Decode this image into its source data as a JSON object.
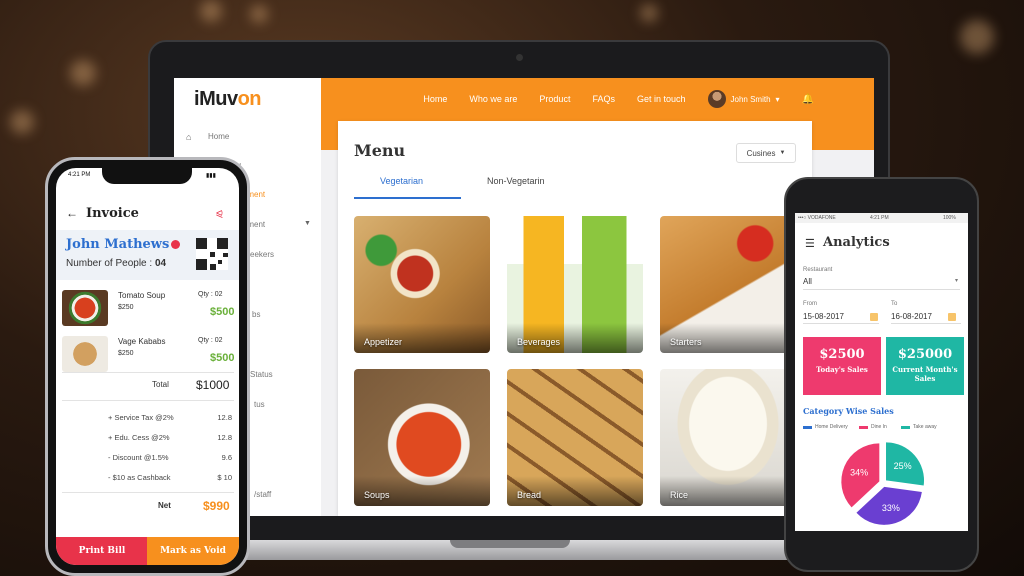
{
  "site": {
    "logo_prefix": "i",
    "logo_text": "Muv",
    "logo_accent": "on",
    "nav": [
      "Home",
      "Who we are",
      "Product",
      "FAQs",
      "Get in touch"
    ],
    "user_name": "John Smith",
    "user_caret": "▾"
  },
  "sidebar": {
    "items": [
      {
        "label": "Home",
        "active": false
      },
      {
        "label": "rd",
        "active": false
      },
      {
        "label": "agement",
        "active": true
      },
      {
        "label": "agement",
        "active": false
      },
      {
        "label": "eekers",
        "active": false
      },
      {
        "label": "bs",
        "active": false
      },
      {
        "label": "Status",
        "active": false
      },
      {
        "label": "tus",
        "active": false
      },
      {
        "label": "/staff",
        "active": false
      }
    ]
  },
  "menu": {
    "title": "Menu",
    "cuisines_label": "Cusines",
    "tabs": [
      {
        "label": "Vegetarian",
        "active": true
      },
      {
        "label": "Non-Vegetarin",
        "active": false
      }
    ],
    "tiles": [
      "Appetizer",
      "Beverages",
      "Starters",
      "Soups",
      "Bread",
      "Rice"
    ]
  },
  "invoice": {
    "status_time": "4:21 PM",
    "title": "Invoice",
    "customer_name": "John Mathews",
    "people_label": "Number of People :",
    "people_count": "04",
    "items": [
      {
        "name": "Tomato Soup",
        "price": "$250",
        "qty": "Qty : 02",
        "amount": "$500"
      },
      {
        "name": "Vage Kababs",
        "price": "$250",
        "qty": "Qty : 02",
        "amount": "$500"
      }
    ],
    "total_label": "Total",
    "total_value": "$1000",
    "adjustments": [
      {
        "label": "+ Service Tax @2%",
        "value": "12.8"
      },
      {
        "label": "+ Edu. Cess @2%",
        "value": "12.8"
      },
      {
        "label": "- Discount @1.5%",
        "value": "9.6"
      },
      {
        "label": "- $10 as Cashback",
        "value": "$ 10"
      }
    ],
    "net_label": "Net",
    "net_value": "$990",
    "print_label": "Print Bill",
    "void_label": "Mark as Void"
  },
  "analytics": {
    "status_carrier": "•••○ VODAFONE",
    "status_time": "4:21 PM",
    "status_battery": "100%",
    "title": "Analytics",
    "restaurant_label": "Restaurant",
    "restaurant_value": "All",
    "from_label": "From",
    "from_value": "15-08-2017",
    "to_label": "To",
    "to_value": "16-08-2017",
    "today_sales_value": "$2500",
    "today_sales_label": "Today's Sales",
    "month_sales_value": "$25000",
    "month_sales_label": "Current Month's Sales",
    "category_title": "Category Wise Sales",
    "colors": {
      "pink": "#ee3a6e",
      "teal": "#1fb7a4",
      "blue": "#2d6fcf",
      "orange": "#f7901e"
    }
  },
  "chart_data": {
    "type": "pie",
    "title": "Category Wise Sales",
    "categories": [
      "Home Delivery",
      "Dine In",
      "Take away"
    ],
    "values": [
      34,
      33,
      25
    ],
    "labels": [
      "34%",
      "33%",
      "25%"
    ],
    "colors": [
      "#ee3a6e",
      "#6a3fd1",
      "#1fb7a4"
    ],
    "legend_placement": "top"
  }
}
